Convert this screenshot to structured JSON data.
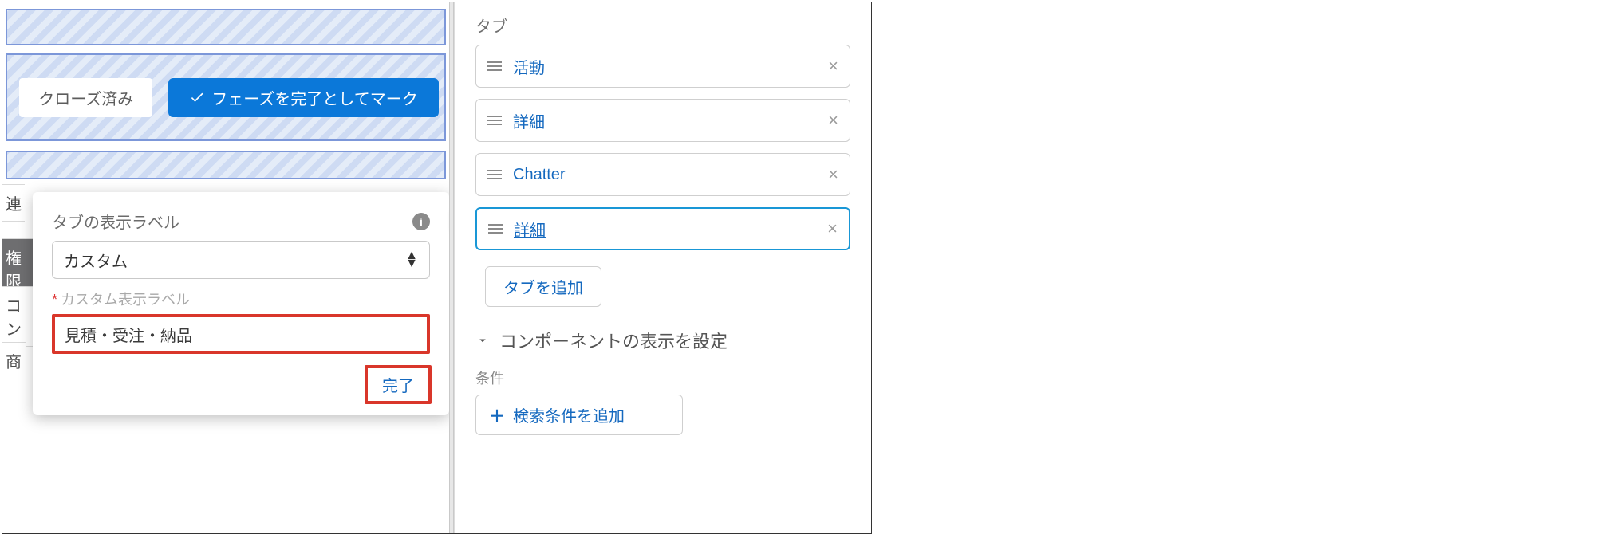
{
  "preview": {
    "closed_stage": "クローズ済み",
    "mark_complete": "フェーズを完了としてマーク",
    "frag1": "連",
    "frag2": "権限",
    "frag3": "コン",
    "frag4": "商"
  },
  "popover": {
    "label": "タブの表示ラベル",
    "select_value": "カスタム",
    "custom_label": "カスタム表示ラベル",
    "input_value": "見積・受注・納品",
    "done": "完了"
  },
  "panel": {
    "tabs_title": "タブ",
    "tabs": [
      {
        "label": "活動"
      },
      {
        "label": "詳細"
      },
      {
        "label": "Chatter"
      },
      {
        "label": "詳細"
      }
    ],
    "add_tab": "タブを追加",
    "visibility_title": "コンポーネントの表示を設定",
    "conditions_label": "条件",
    "add_condition": "検索条件を追加"
  }
}
